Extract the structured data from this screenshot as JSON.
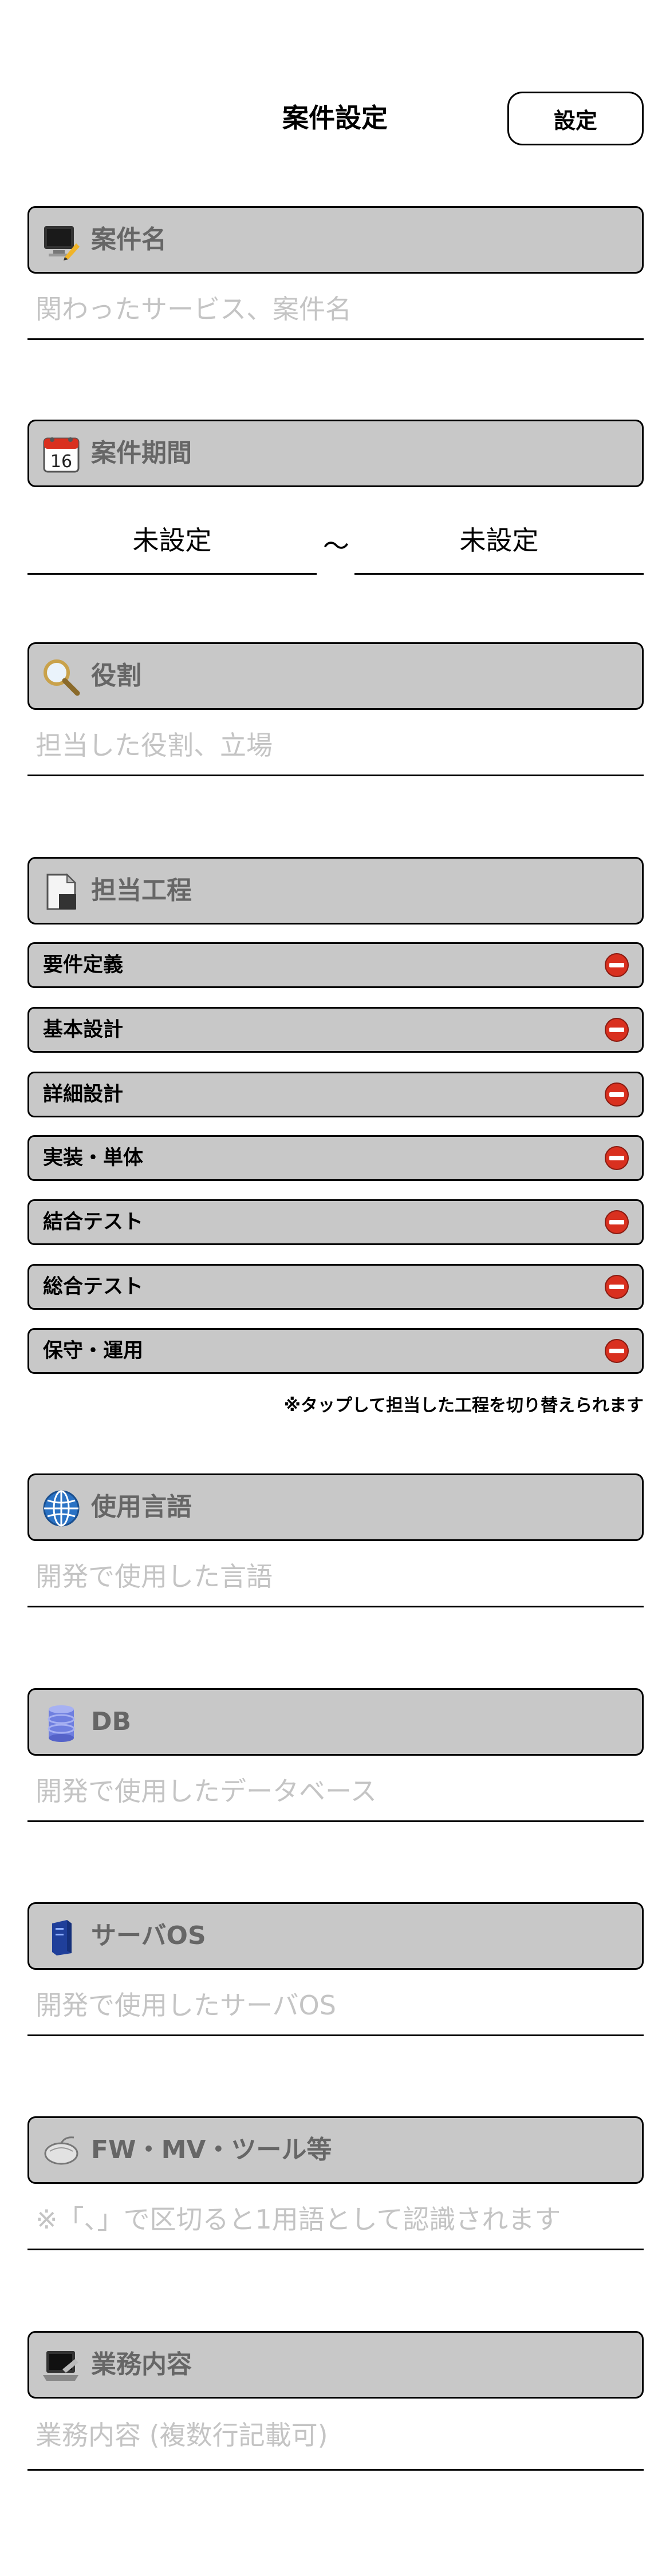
{
  "header": {
    "title": "案件設定",
    "set_button": "設定"
  },
  "sections": {
    "project_name": {
      "label": "案件名",
      "placeholder": "関わったサービス、案件名",
      "icon": "monitor-pencil-icon"
    },
    "period": {
      "label": "案件期間",
      "start": "未設定",
      "separator": "〜",
      "end": "未設定",
      "icon": "calendar-icon"
    },
    "role": {
      "label": "役割",
      "placeholder": "担当した役割、立場",
      "icon": "magnifier-icon"
    },
    "process": {
      "label": "担当工程",
      "icon": "document-icon",
      "items": [
        "要件定義",
        "基本設計",
        "詳細設計",
        "実装・単体",
        "結合テスト",
        "総合テスト",
        "保守・運用"
      ],
      "note": "※タップして担当した工程を切り替えられます"
    },
    "language": {
      "label": "使用言語",
      "placeholder": "開発で使用した言語",
      "icon": "globe-icon"
    },
    "db": {
      "label": "DB",
      "placeholder": "開発で使用したデータベース",
      "icon": "database-icon"
    },
    "server_os": {
      "label": "サーバOS",
      "placeholder": "開発で使用したサーバOS",
      "icon": "server-icon"
    },
    "tools": {
      "label": "FW・MV・ツール等",
      "placeholder": "※「、」で区切ると1用語として認識されます",
      "icon": "mouse-icon"
    },
    "business": {
      "label": "業務内容",
      "placeholder": "業務内容 (複数行記載可)",
      "icon": "laptop-icon"
    }
  },
  "colors": {
    "header_bg": "#c8c8c8",
    "placeholder": "#c4c4c4",
    "minus_red": "#d9301f",
    "label_gray": "#666666"
  }
}
